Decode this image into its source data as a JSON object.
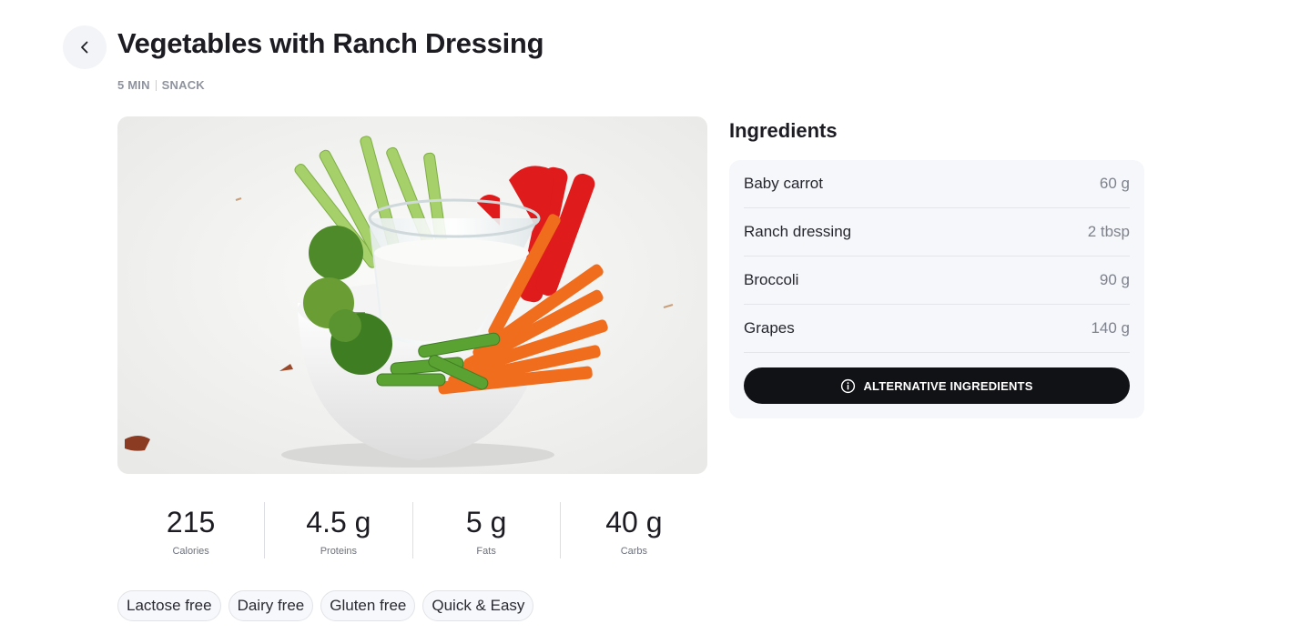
{
  "header": {
    "title": "Vegetables with Ranch Dressing",
    "meta": [
      "5 MIN",
      "SNACK"
    ]
  },
  "photo": {
    "description_icon": "vegetables-with-dip-image"
  },
  "nutrition": [
    {
      "value": "215",
      "label": "Calories"
    },
    {
      "value": "4.5 g",
      "label": "Proteins"
    },
    {
      "value": "5 g",
      "label": "Fats"
    },
    {
      "value": "40 g",
      "label": "Carbs"
    }
  ],
  "tags": [
    "Lactose free",
    "Dairy free",
    "Gluten free",
    "Quick & Easy"
  ],
  "ingredients": {
    "title": "Ingredients",
    "items": [
      {
        "name": "Baby carrot",
        "amount": "60 g"
      },
      {
        "name": "Ranch dressing",
        "amount": "2 tbsp"
      },
      {
        "name": "Broccoli",
        "amount": "90 g"
      },
      {
        "name": "Grapes",
        "amount": "140 g"
      }
    ],
    "alt_button_label": "ALTERNATIVE INGREDIENTS"
  },
  "icons": {
    "back": "chevron-left-icon",
    "info": "info-circle-icon"
  },
  "colors": {
    "button_bg": "#111216",
    "card_bg": "#f6f7fa",
    "back_bg": "#f3f4f8"
  }
}
